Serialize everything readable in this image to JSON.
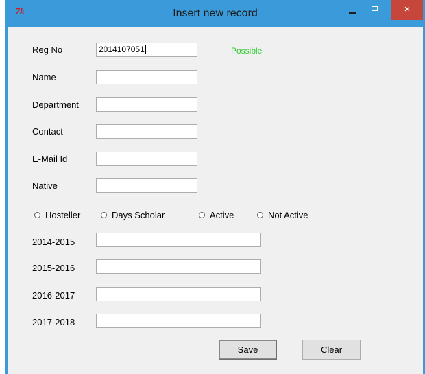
{
  "window": {
    "title": "Insert new record",
    "logo": "7k",
    "close_glyph": "×"
  },
  "form": {
    "reg_no": {
      "label": "Reg No",
      "value": "2014107051"
    },
    "status": "Possible",
    "name": {
      "label": "Name",
      "value": ""
    },
    "department": {
      "label": "Department",
      "value": ""
    },
    "contact": {
      "label": "Contact",
      "value": ""
    },
    "email": {
      "label": "E-Mail Id",
      "value": ""
    },
    "native": {
      "label": "Native",
      "value": ""
    },
    "radios": [
      {
        "label": "Hosteller"
      },
      {
        "label": "Days Scholar"
      },
      {
        "label": "Active"
      },
      {
        "label": "Not Active"
      }
    ],
    "years": [
      {
        "label": "2014-2015",
        "value": ""
      },
      {
        "label": "2015-2016",
        "value": ""
      },
      {
        "label": "2016-2017",
        "value": ""
      },
      {
        "label": "2017-2018",
        "value": ""
      }
    ]
  },
  "buttons": {
    "save": "Save",
    "clear": "Clear"
  },
  "icons": {
    "minimize": "minimize-icon",
    "maximize": "maximize-icon",
    "close": "close-icon",
    "radio": "radio-button-icon"
  }
}
